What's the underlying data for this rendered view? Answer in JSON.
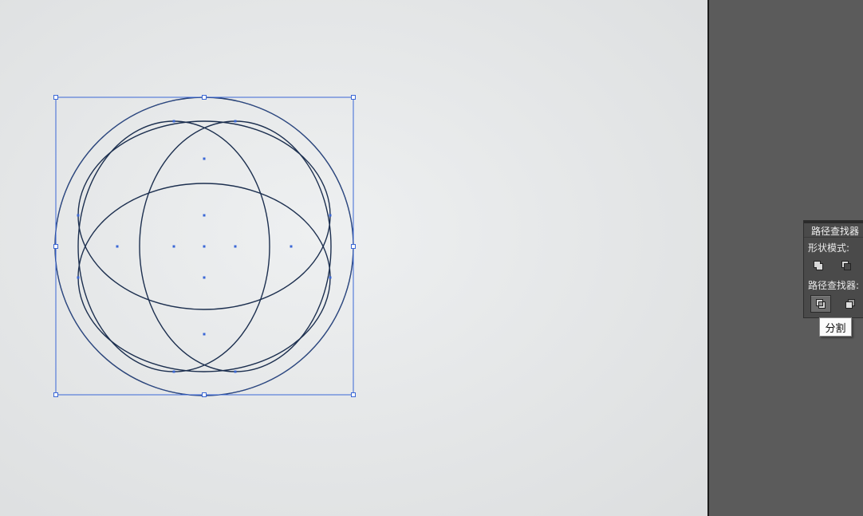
{
  "pathfinder_panel": {
    "title": "路径查找器",
    "shape_modes_label": "形状模式:",
    "pathfinders_label": "路径查找器:",
    "buttons": [
      {
        "icon": "unite-icon"
      },
      {
        "icon": "minus-front-icon"
      },
      {
        "icon": "divide-icon",
        "selected": true
      },
      {
        "icon": "trim-icon"
      }
    ],
    "tooltip": "分割"
  },
  "colors": {
    "selection": "#3a67d6",
    "path_stroke": "#1c2f4f",
    "panel_bg": "#4a4a4a",
    "dock_bg": "#5b5b5b"
  }
}
